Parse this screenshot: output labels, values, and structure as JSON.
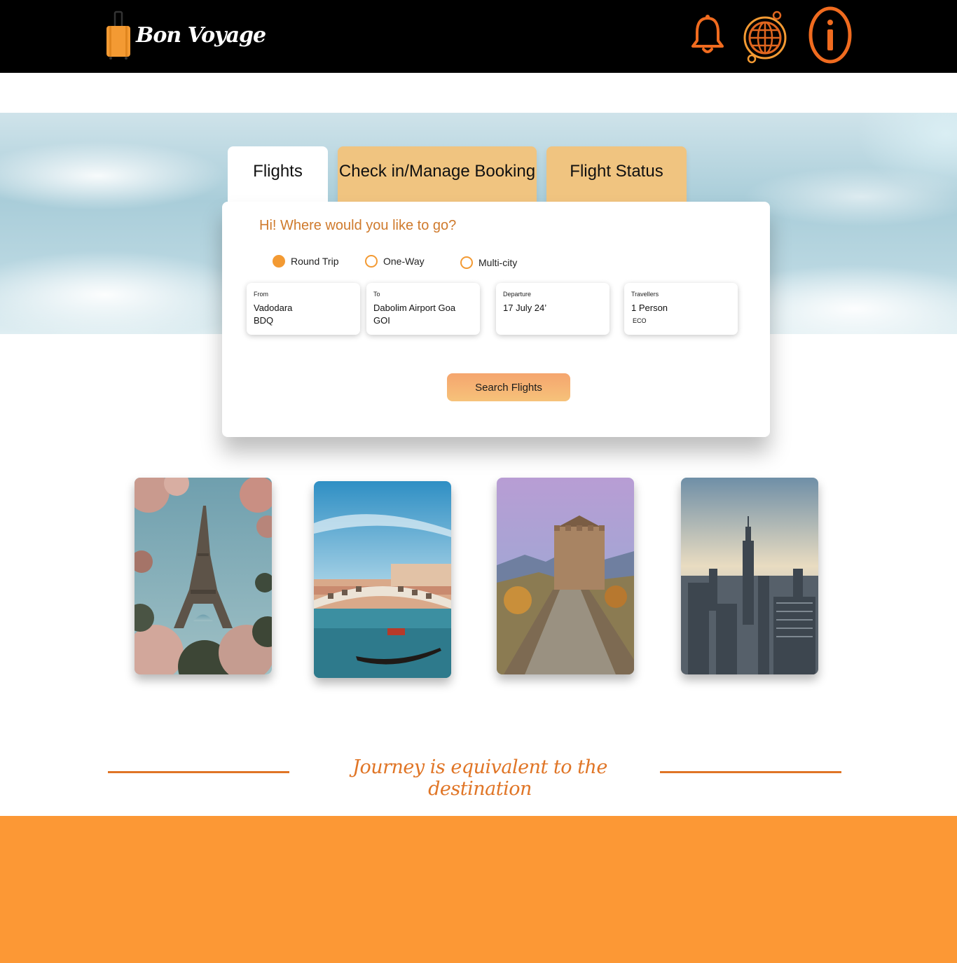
{
  "brand": {
    "name": "Bon Voyage",
    "logo_icon": "suitcase-icon",
    "accent": "#f39a33"
  },
  "header": {
    "icons": [
      "bell-icon",
      "globe-icon",
      "info-icon"
    ]
  },
  "tabs": [
    {
      "label": "Flights",
      "active": true
    },
    {
      "label": "Check in/Manage Booking",
      "active": false
    },
    {
      "label": "Flight Status",
      "active": false
    }
  ],
  "booking": {
    "greeting": "Hi! Where would you like to go?",
    "trip_types": [
      {
        "label": "Round Trip",
        "selected": true
      },
      {
        "label": "One-Way",
        "selected": false
      },
      {
        "label": "Multi-city",
        "selected": false
      }
    ],
    "from": {
      "label": "From",
      "city": "Vadodara",
      "code": "BDQ"
    },
    "to": {
      "label": "To",
      "city": "Dabolim Airport Goa",
      "code": "GOI"
    },
    "departure": {
      "label": "Departure",
      "value": "17 July 24’"
    },
    "travellers": {
      "label": "Travellers",
      "value": "1 Person",
      "class": "ECO"
    },
    "search_label": "Search Flights"
  },
  "destinations": [
    "Eiffel Tower",
    "Venice",
    "Great Wall",
    "New York"
  ],
  "tagline": "Journey is equivalent to the destination",
  "colors": {
    "header_bg": "#000000",
    "tab_inactive": "#f0c480",
    "tagline": "#e07526",
    "footer": "#fc9835"
  }
}
